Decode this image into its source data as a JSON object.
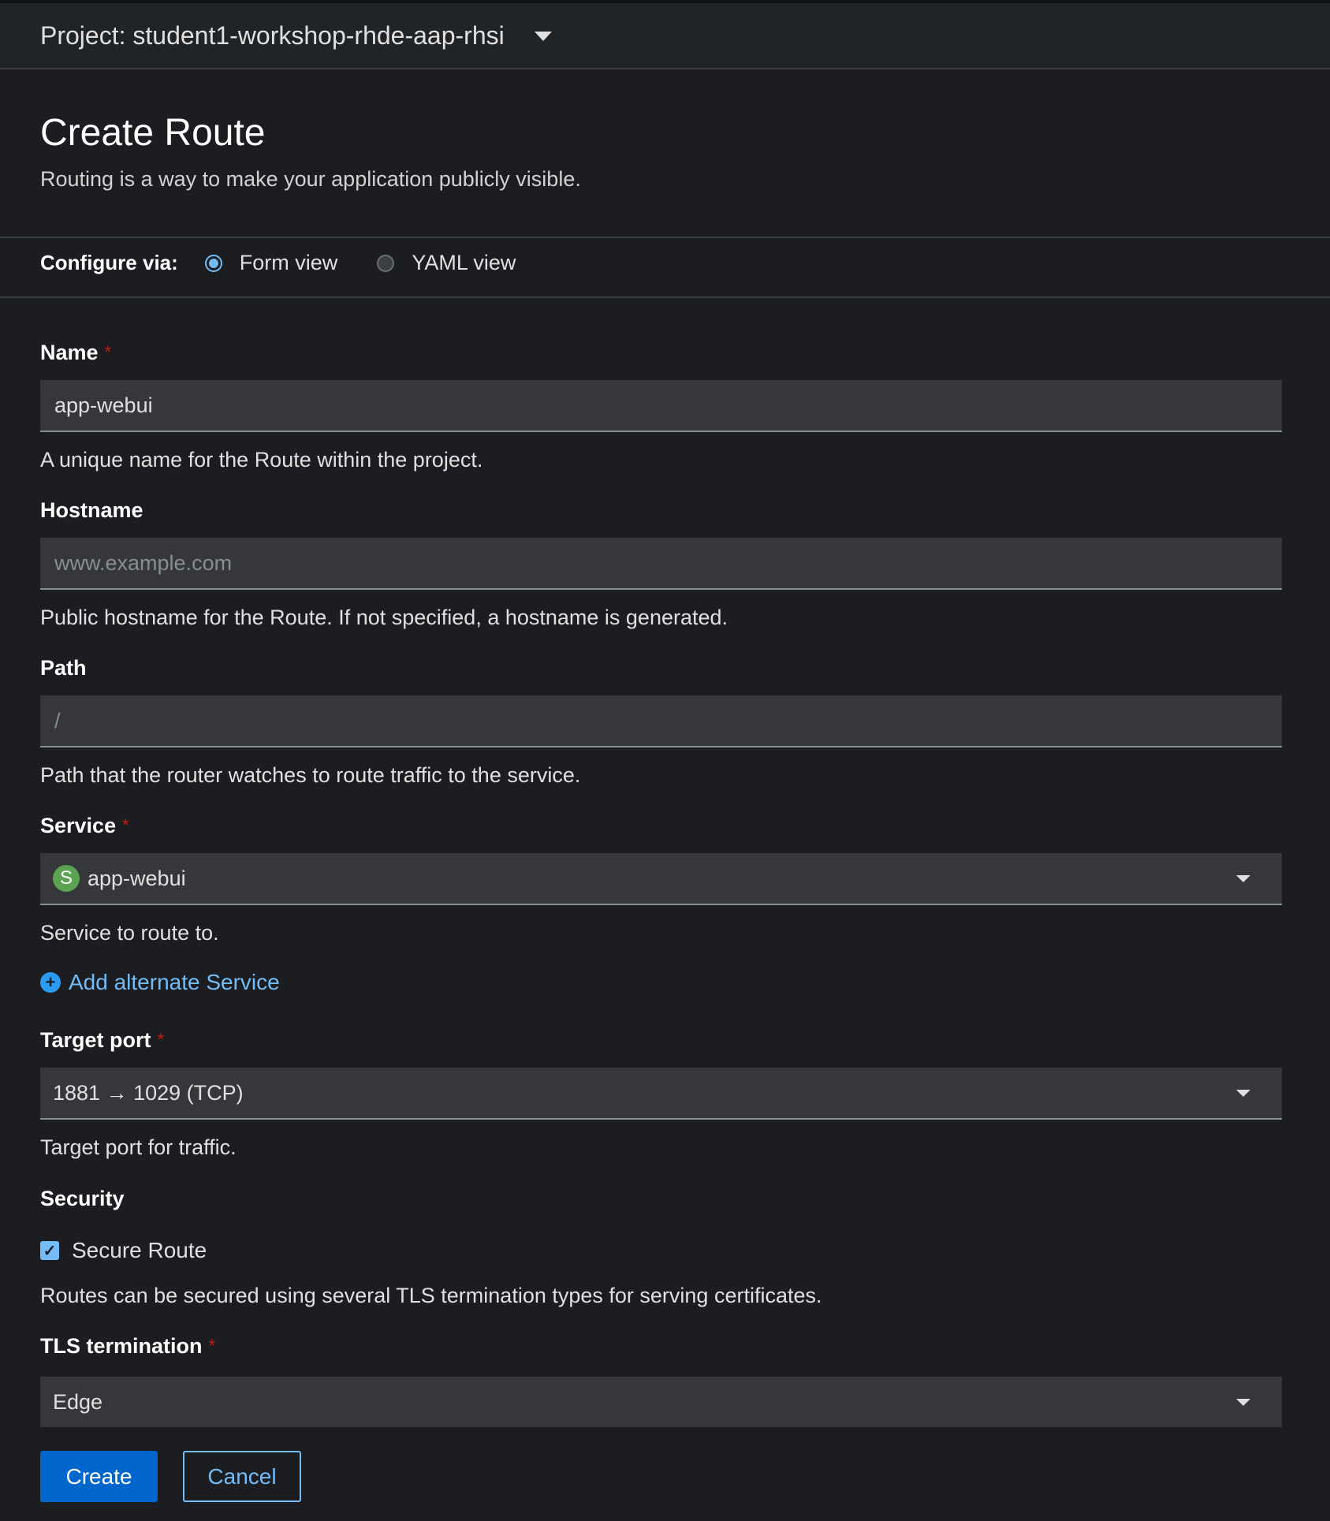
{
  "project_bar": {
    "label": "Project: student1-workshop-rhde-aap-rhsi"
  },
  "page": {
    "title": "Create Route",
    "description": "Routing is a way to make your application publicly visible."
  },
  "configure": {
    "label": "Configure via:",
    "options": [
      {
        "label": "Form view",
        "selected": true
      },
      {
        "label": "YAML view",
        "selected": false
      }
    ]
  },
  "fields": {
    "name": {
      "label": "Name",
      "required": "*",
      "value": "app-webui",
      "helper": "A unique name for the Route within the project."
    },
    "hostname": {
      "label": "Hostname",
      "placeholder": "www.example.com",
      "helper": "Public hostname for the Route. If not specified, a hostname is generated."
    },
    "path": {
      "label": "Path",
      "placeholder": "/",
      "helper": "Path that the router watches to route traffic to the service."
    },
    "service": {
      "label": "Service",
      "required": "*",
      "badge": "S",
      "value": "app-webui",
      "helper": "Service to route to."
    },
    "target_port": {
      "label": "Target port",
      "required": "*",
      "value": "1881 → 1029 (TCP)",
      "helper": "Target port for traffic."
    },
    "tls": {
      "label": "TLS termination",
      "required": "*",
      "value": "Edge"
    }
  },
  "add_alternate": {
    "label": "Add alternate Service"
  },
  "security": {
    "heading": "Security",
    "checkbox_label": "Secure Route",
    "checked": true,
    "helper": "Routes can be secured using several TLS termination types for serving certificates."
  },
  "buttons": {
    "create": "Create",
    "cancel": "Cancel"
  },
  "colors": {
    "accent": "#73bcf7",
    "primary_button": "#0066cc",
    "required": "#c9190b",
    "service_badge": "#5ba352"
  },
  "icons": {
    "caret": "caret-down-icon",
    "plus": "plus-circle-icon",
    "check": "check-icon"
  }
}
